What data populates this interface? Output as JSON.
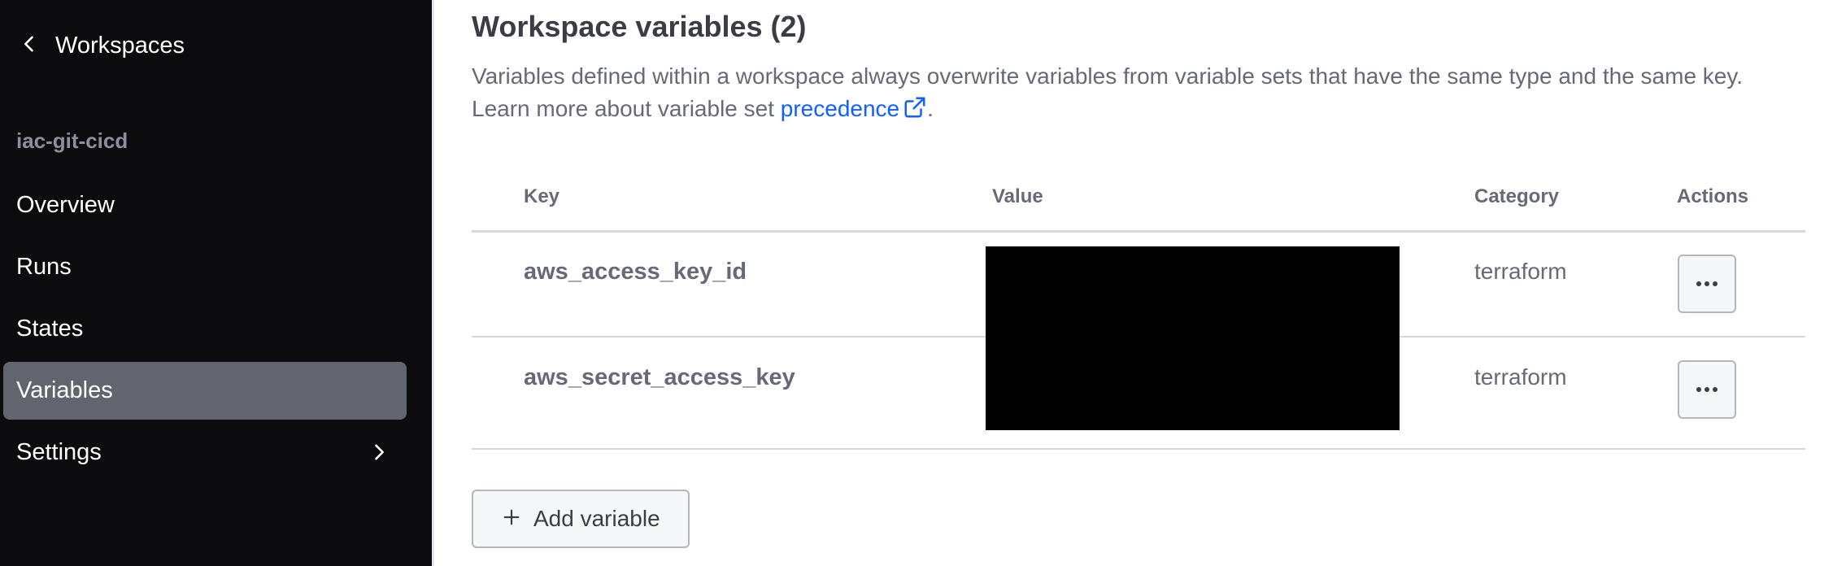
{
  "sidebar": {
    "back_label": "Workspaces",
    "workspace_name": "iac-git-cicd",
    "items": [
      {
        "label": "Overview"
      },
      {
        "label": "Runs"
      },
      {
        "label": "States"
      },
      {
        "label": "Variables"
      },
      {
        "label": "Settings"
      }
    ],
    "active_item": "Variables"
  },
  "main": {
    "title": "Workspace variables (2)",
    "description_line1": "Variables defined within a workspace always overwrite variables from variable sets that have the same type and the same key.",
    "description_line2_prefix": "Learn more about variable set ",
    "description_link": "precedence",
    "description_suffix": ".",
    "table": {
      "headers": {
        "key": "Key",
        "value": "Value",
        "category": "Category",
        "actions": "Actions"
      },
      "rows": [
        {
          "key": "aws_access_key_id",
          "category": "terraform"
        },
        {
          "key": "aws_secret_access_key",
          "category": "terraform"
        }
      ]
    },
    "add_button_label": "Add variable"
  },
  "colors": {
    "sidebar_bg": "#0c0c0e",
    "active_item_bg": "#62656d",
    "link": "#1060ff",
    "redaction": "#000000"
  },
  "icons": {
    "back": "chevron-left-icon",
    "settings_expand": "chevron-right-icon",
    "external_link": "external-link-icon",
    "row_actions": "more-horizontal-icon",
    "add": "plus-icon"
  }
}
